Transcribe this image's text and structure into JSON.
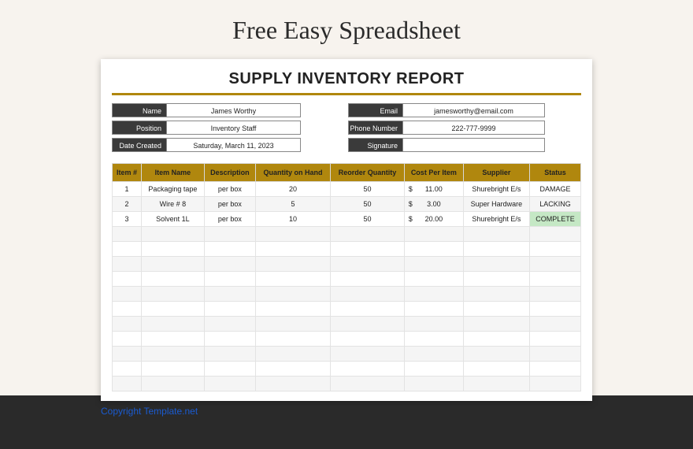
{
  "page_title": "Free Easy Spreadsheet",
  "report_title": "SUPPLY INVENTORY REPORT",
  "info_left": [
    {
      "label": "Name",
      "value": "James Worthy"
    },
    {
      "label": "Position",
      "value": "Inventory Staff"
    },
    {
      "label": "Date Created",
      "value": "Saturday, March 11, 2023"
    }
  ],
  "info_right": [
    {
      "label": "Email",
      "value": "jamesworthy@email.com"
    },
    {
      "label": "Phone Number",
      "value": "222-777-9999"
    },
    {
      "label": "Signature",
      "value": ""
    }
  ],
  "columns": [
    "Item #",
    "Item Name",
    "Description",
    "Quantity on Hand",
    "Reorder Quantity",
    "Cost Per Item",
    "Supplier",
    "Status"
  ],
  "rows": [
    {
      "num": "1",
      "name": "Packaging tape",
      "desc": "per box",
      "qoh": "20",
      "reorder": "50",
      "cost": "11.00",
      "supplier": "Shurebright E/s",
      "status": "DAMAGE",
      "status_class": ""
    },
    {
      "num": "2",
      "name": "Wire # 8",
      "desc": "per box",
      "qoh": "5",
      "reorder": "50",
      "cost": "3.00",
      "supplier": "Super Hardware",
      "status": "LACKING",
      "status_class": ""
    },
    {
      "num": "3",
      "name": "Solvent 1L",
      "desc": "per box",
      "qoh": "10",
      "reorder": "50",
      "cost": "20.00",
      "supplier": "Shurebright E/s",
      "status": "COMPLETE",
      "status_class": "status-complete"
    }
  ],
  "empty_rows": 11,
  "copyright": "Copyright Template.net"
}
